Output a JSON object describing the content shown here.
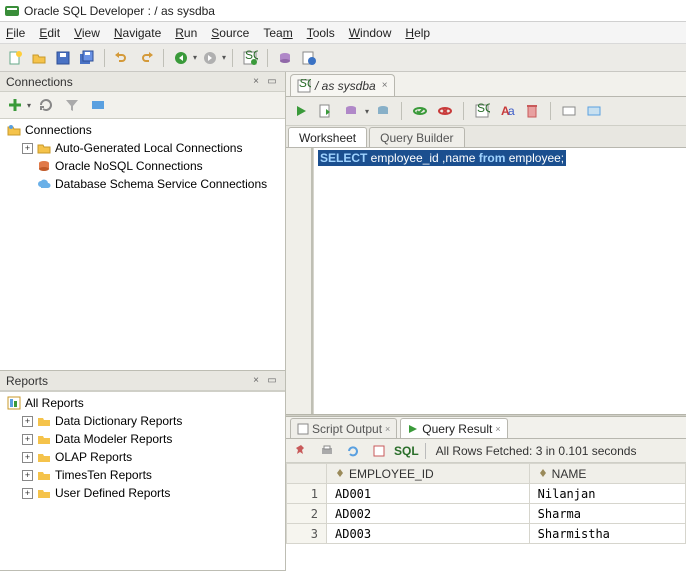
{
  "app": {
    "title": "Oracle SQL Developer : / as sysdba"
  },
  "menubar": {
    "items": [
      "File",
      "Edit",
      "View",
      "Navigate",
      "Run",
      "Source",
      "Team",
      "Tools",
      "Window",
      "Help"
    ]
  },
  "toolbar": {
    "icons": [
      "new",
      "open",
      "save",
      "save-all",
      "undo",
      "redo",
      "back",
      "forward",
      "sql-tool",
      "db-tool",
      "sql-script"
    ]
  },
  "connections_panel": {
    "title": "Connections",
    "root": "Connections",
    "items": [
      {
        "label": "Auto-Generated Local Connections",
        "icon": "folder"
      },
      {
        "label": "Oracle NoSQL Connections",
        "icon": "nosql"
      },
      {
        "label": "Database Schema Service Connections",
        "icon": "cloud"
      }
    ]
  },
  "reports_panel": {
    "title": "Reports",
    "root": "All Reports",
    "items": [
      {
        "label": "Data Dictionary Reports"
      },
      {
        "label": "Data Modeler Reports"
      },
      {
        "label": "OLAP Reports"
      },
      {
        "label": "TimesTen Reports"
      },
      {
        "label": "User Defined Reports"
      }
    ]
  },
  "editor": {
    "tab_label": "/ as sysdba",
    "sub_tabs": {
      "worksheet": "Worksheet",
      "query_builder": "Query Builder"
    },
    "sql": {
      "kw1": "SELECT",
      "mid": " employee_id ,name ",
      "kw2": "from",
      "end": " employee;"
    }
  },
  "results": {
    "tabs": {
      "script_output": "Script Output",
      "query_result": "Query Result"
    },
    "sql_label": "SQL",
    "status": "All Rows Fetched: 3 in 0.101 seconds",
    "columns": [
      "EMPLOYEE_ID",
      "NAME"
    ],
    "rows": [
      {
        "n": "1",
        "id": "AD001",
        "name": "Nilanjan"
      },
      {
        "n": "2",
        "id": "AD002",
        "name": "Sharma"
      },
      {
        "n": "3",
        "id": "AD003",
        "name": "Sharmistha"
      }
    ]
  }
}
